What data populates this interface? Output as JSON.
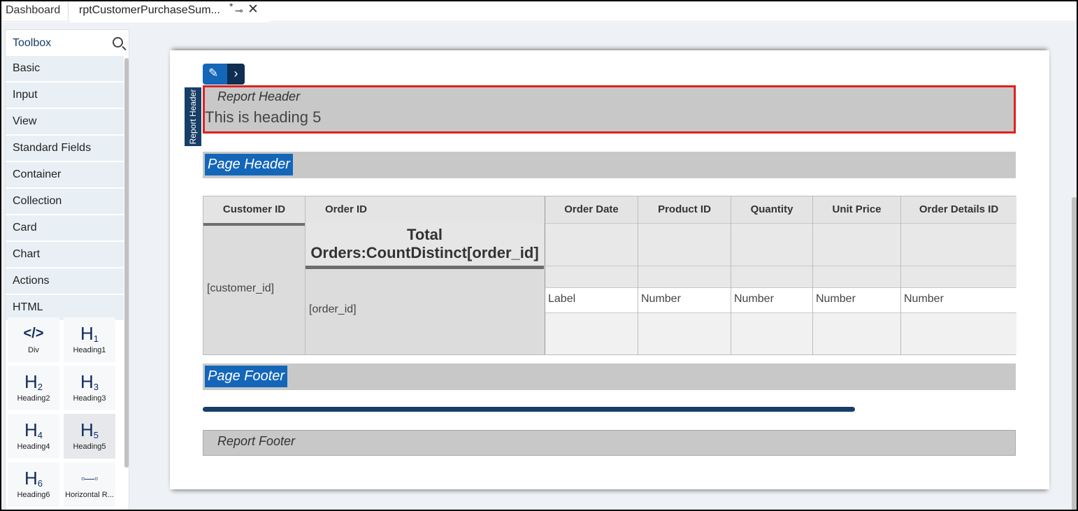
{
  "tabs": {
    "dashboard": "Dashboard",
    "active": "rptCustomerPurchaseSum...",
    "modified_mark": "*"
  },
  "toolbox": {
    "title": "Toolbox",
    "categories": [
      "Basic",
      "Input",
      "View",
      "Standard Fields",
      "Container",
      "Collection",
      "Card",
      "Chart",
      "Actions",
      "HTML"
    ],
    "tools": [
      {
        "glyph": "</>",
        "sub": "",
        "label": "Div"
      },
      {
        "glyph": "H",
        "sub": "1",
        "label": "Heading1"
      },
      {
        "glyph": "H",
        "sub": "2",
        "label": "Heading2"
      },
      {
        "glyph": "H",
        "sub": "3",
        "label": "Heading3"
      },
      {
        "glyph": "H",
        "sub": "4",
        "label": "Heading4"
      },
      {
        "glyph": "H",
        "sub": "5",
        "label": "Heading5"
      },
      {
        "glyph": "H",
        "sub": "6",
        "label": "Heading6"
      },
      {
        "glyph": "▫—▫",
        "sub": "",
        "label": "Horizontal R..."
      }
    ]
  },
  "report": {
    "report_header_tag": "Report Header",
    "report_header_title": "Report Header",
    "heading5_text": "This is heading 5",
    "page_header": "Page Header",
    "table": {
      "headers": [
        "Customer ID",
        "Order ID",
        "Order Date",
        "Product ID",
        "Quantity",
        "Unit Price",
        "Order Details ID"
      ],
      "customer_field": "[customer_id]",
      "group_total": "Total Orders:CountDistinct[order_id]",
      "order_field": "[order_id]",
      "detail_row": [
        "Label",
        "Number",
        "Number",
        "Number",
        "Number"
      ]
    },
    "page_footer": "Page Footer",
    "report_footer": "Report Footer"
  },
  "colors": {
    "accent_blue": "#1466b8",
    "dark_navy": "#173e66",
    "selection_red": "#e02020"
  }
}
